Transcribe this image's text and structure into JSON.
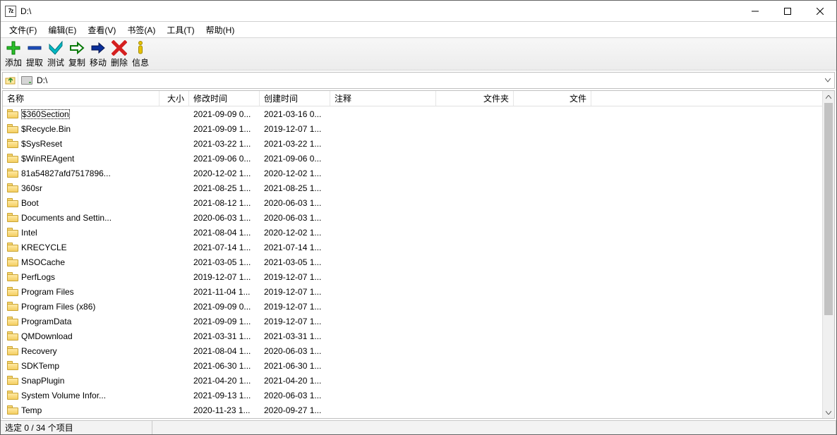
{
  "titlebar": {
    "title": "D:\\"
  },
  "menu": {
    "file": "文件(F)",
    "edit": "编辑(E)",
    "view": "查看(V)",
    "bookmarks": "书签(A)",
    "tools": "工具(T)",
    "help": "帮助(H)"
  },
  "toolbar": {
    "add": "添加",
    "extract": "提取",
    "test": "测试",
    "copy": "复制",
    "move": "移动",
    "delete": "删除",
    "info": "信息"
  },
  "address": {
    "path": "D:\\"
  },
  "columns": {
    "name": "名称",
    "size": "大小",
    "modified": "修改时间",
    "created": "创建时间",
    "comment": "注释",
    "folders": "文件夹",
    "files": "文件"
  },
  "rows": [
    {
      "name": "$360Section",
      "mod": "2021-09-09 0...",
      "cre": "2021-03-16 0...",
      "selected": true
    },
    {
      "name": "$Recycle.Bin",
      "mod": "2021-09-09 1...",
      "cre": "2019-12-07 1..."
    },
    {
      "name": "$SysReset",
      "mod": "2021-03-22 1...",
      "cre": "2021-03-22 1..."
    },
    {
      "name": "$WinREAgent",
      "mod": "2021-09-06 0...",
      "cre": "2021-09-06 0..."
    },
    {
      "name": "81a54827afd7517896...",
      "mod": "2020-12-02 1...",
      "cre": "2020-12-02 1..."
    },
    {
      "name": "360sr",
      "mod": "2021-08-25 1...",
      "cre": "2021-08-25 1..."
    },
    {
      "name": "Boot",
      "mod": "2021-08-12 1...",
      "cre": "2020-06-03 1..."
    },
    {
      "name": "Documents and Settin...",
      "mod": "2020-06-03 1...",
      "cre": "2020-06-03 1..."
    },
    {
      "name": "Intel",
      "mod": "2021-08-04 1...",
      "cre": "2020-12-02 1..."
    },
    {
      "name": "KRECYCLE",
      "mod": "2021-07-14 1...",
      "cre": "2021-07-14 1..."
    },
    {
      "name": "MSOCache",
      "mod": "2021-03-05 1...",
      "cre": "2021-03-05 1..."
    },
    {
      "name": "PerfLogs",
      "mod": "2019-12-07 1...",
      "cre": "2019-12-07 1..."
    },
    {
      "name": "Program Files",
      "mod": "2021-11-04 1...",
      "cre": "2019-12-07 1..."
    },
    {
      "name": "Program Files (x86)",
      "mod": "2021-09-09 0...",
      "cre": "2019-12-07 1..."
    },
    {
      "name": "ProgramData",
      "mod": "2021-09-09 1...",
      "cre": "2019-12-07 1..."
    },
    {
      "name": "QMDownload",
      "mod": "2021-03-31 1...",
      "cre": "2021-03-31 1..."
    },
    {
      "name": "Recovery",
      "mod": "2021-08-04 1...",
      "cre": "2020-06-03 1..."
    },
    {
      "name": "SDKTemp",
      "mod": "2021-06-30 1...",
      "cre": "2021-06-30 1..."
    },
    {
      "name": "SnapPlugin",
      "mod": "2021-04-20 1...",
      "cre": "2021-04-20 1..."
    },
    {
      "name": "System Volume Infor...",
      "mod": "2021-09-13 1...",
      "cre": "2020-06-03 1..."
    },
    {
      "name": "Temp",
      "mod": "2020-11-23 1...",
      "cre": "2020-09-27 1..."
    }
  ],
  "status": {
    "selection": "选定 0 / 34 个项目"
  }
}
